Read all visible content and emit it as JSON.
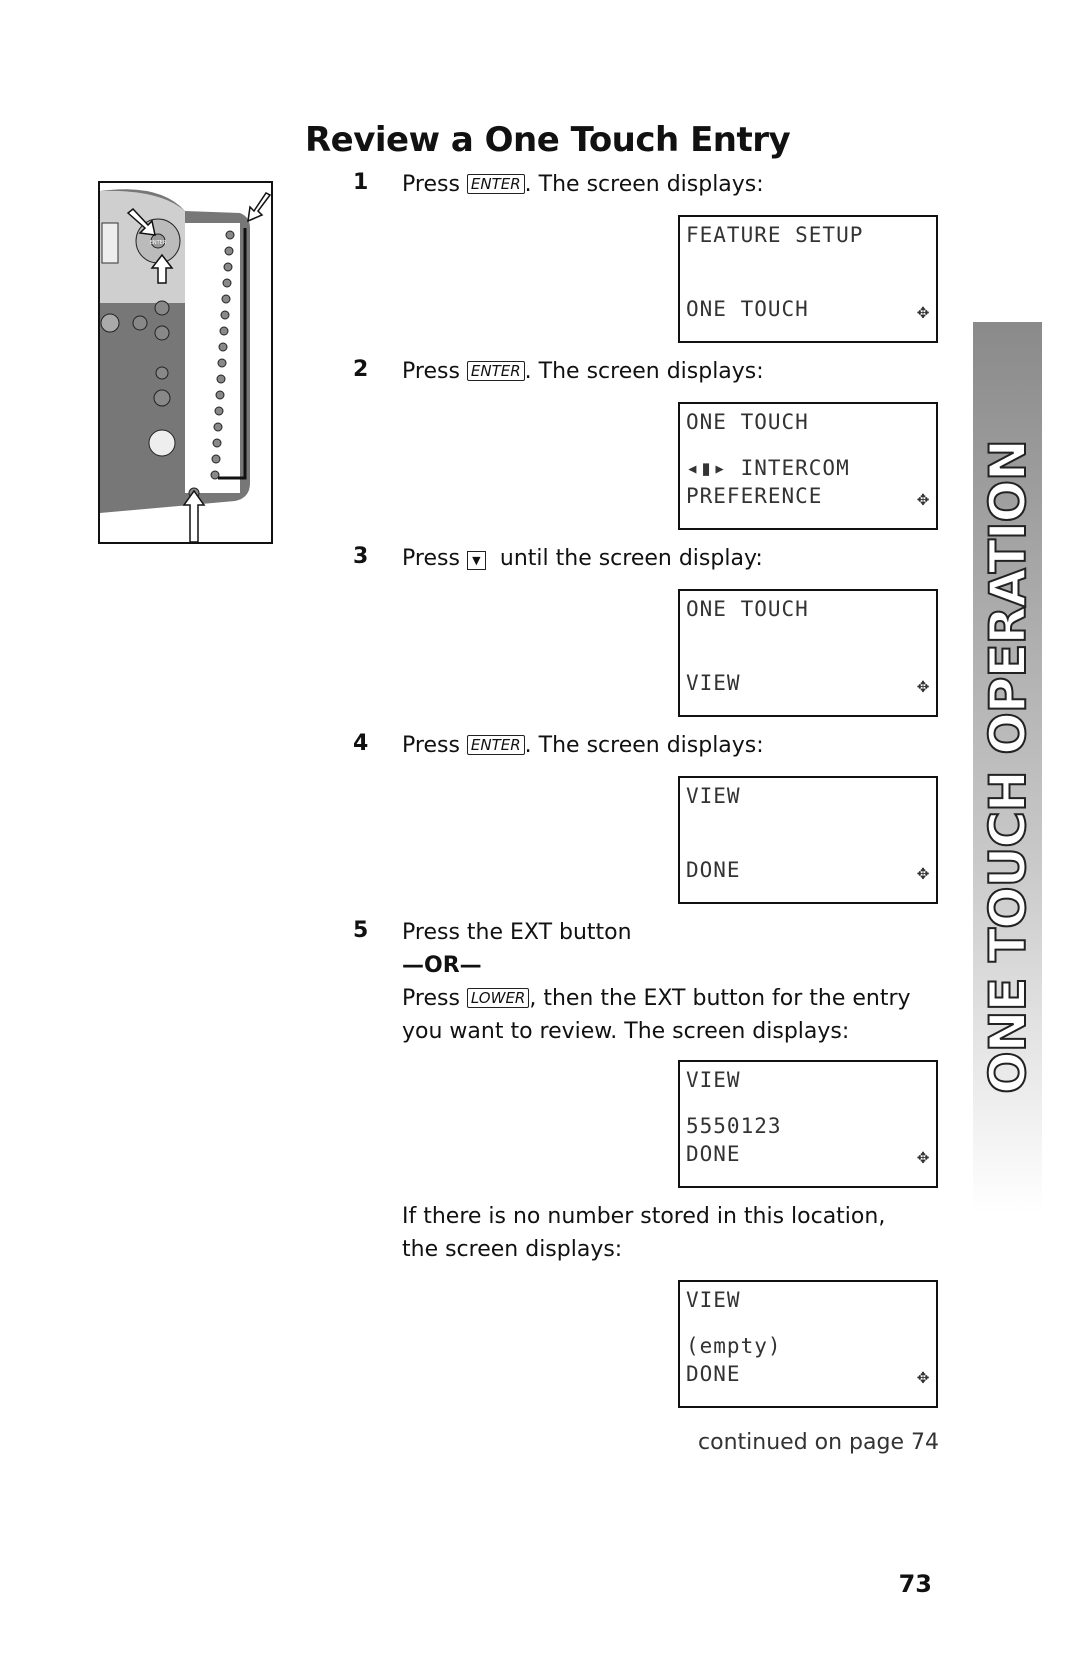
{
  "title": "Review a One Touch Entry",
  "steps": [
    {
      "num": "1",
      "pre": "Press ",
      "key": "ENTER",
      "post": ". The screen displays:"
    },
    {
      "num": "2",
      "pre": "Press ",
      "key": "ENTER",
      "post": ". The screen displays:"
    },
    {
      "num": "3",
      "pre": "Press ",
      "key": "▼",
      "post": "  until the screen display:"
    },
    {
      "num": "4",
      "pre": "Press ",
      "key": "ENTER",
      "post": ". The screen displays:"
    },
    {
      "num": "5",
      "line1": "Press the EXT button",
      "or": "—OR—",
      "pre": "Press ",
      "key": "LOWER",
      "post": ", then the EXT button for the entry",
      "line3": "you want to review.  The screen displays:"
    }
  ],
  "note": {
    "line1": "If there is no number stored in this location,",
    "line2": "the screen displays:"
  },
  "screens": [
    {
      "r1": "FEATURE SETUP",
      "r2": "",
      "r3": "ONE TOUCH"
    },
    {
      "r1": "ONE TOUCH",
      "r2": "◂▮▸ INTERCOM",
      "r3": "PREFERENCE"
    },
    {
      "r1": "ONE TOUCH",
      "r2": "",
      "r3": "VIEW"
    },
    {
      "r1": "VIEW",
      "r2": "",
      "r3": "DONE"
    },
    {
      "r1": "VIEW",
      "r2": "5550123",
      "r3": "DONE"
    },
    {
      "r1": "VIEW",
      "r2": "(empty)",
      "r3": "DONE"
    }
  ],
  "nav_glyph": "✥",
  "side_tab": "ONE TOUCH OPERATION",
  "continued": "continued on page 74",
  "page_number": "73",
  "illustration_labels": {
    "enter": "ENTER",
    "lower": "LOWER",
    "ext": "EXT"
  }
}
